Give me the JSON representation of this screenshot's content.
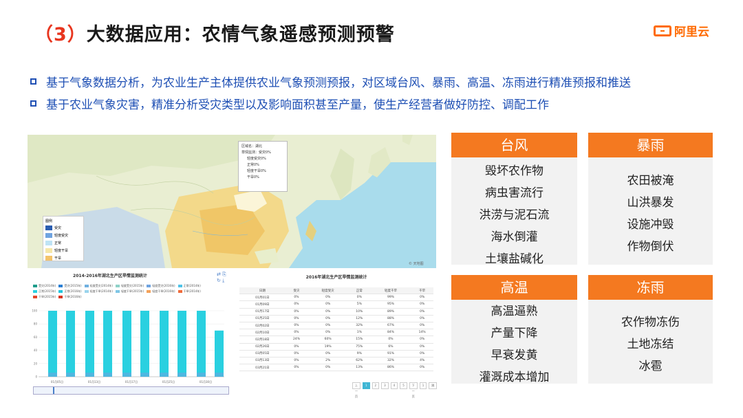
{
  "header": {
    "title_num": "（3）",
    "title_text": "大数据应用：农情气象遥感预测预警",
    "logo_text": "阿里云"
  },
  "bullets": [
    "基于气象数据分析，为农业生产主体提供农业气象预测预报，对区域台风、暴雨、高温、冻雨进行精准预报和推送",
    "基于农业气象灾害，精准分析受灾类型以及影响面积甚至产量，使生产经营者做好防控、调配工作"
  ],
  "map": {
    "tooltip": [
      "区域名：湖北",
      "草情监测：受灾0%",
      "轻度受灾0%",
      "正常0%",
      "轻度干旱0%",
      "干旱0%"
    ],
    "legend_title": "图例",
    "legend": [
      {
        "label": "受灾",
        "color": "#2a5db0"
      },
      {
        "label": "轻度受灾",
        "color": "#6fa3e0"
      },
      {
        "label": "正常",
        "color": "#bfe3f5"
      },
      {
        "label": "轻度干旱",
        "color": "#f6e7a8"
      },
      {
        "label": "干旱",
        "color": "#f4c36a"
      }
    ],
    "credit": "© 天地图"
  },
  "bar_chart": {
    "title": "2014-2016年湖北生产区旱情监测统计",
    "tools": "⇄ ⎘ ↻ ⤓",
    "legend": [
      {
        "label": "受灾(2014年)",
        "color": "#1f9d8b"
      },
      {
        "label": "受灾(2015年)",
        "color": "#2a7fd4"
      },
      {
        "label": "轻度受灾(2014年)",
        "color": "#70b0e0"
      },
      {
        "label": "轻度受灾(2015年)",
        "color": "#8fd1c8"
      },
      {
        "label": "轻度受灾(2016年)",
        "color": "#6fa3e0"
      },
      {
        "label": "正常(2014年)",
        "color": "#4fc3e8"
      },
      {
        "label": "正常(2015年)",
        "color": "#29d0e0"
      },
      {
        "label": "正常(2016年)",
        "color": "#22c6dd"
      },
      {
        "label": "轻度干旱(2014年)",
        "color": "#9ad4ec"
      },
      {
        "label": "轻度干旱(2015年)",
        "color": "#7fc6e6"
      },
      {
        "label": "轻度干旱(2016年)",
        "color": "#f4a15a"
      },
      {
        "label": "干旱(2014年)",
        "color": "#ef6b3a"
      },
      {
        "label": "干旱(2015年)",
        "color": "#e5472b"
      },
      {
        "label": "干旱(2016年)",
        "color": "#d9361e"
      }
    ]
  },
  "chart_data": {
    "type": "bar",
    "title": "2014-2016年湖北生产区旱情监测统计",
    "ylim": [
      0,
      100
    ],
    "yticks": [
      0,
      20,
      40,
      60,
      80,
      100
    ],
    "categories": [
      "01月05日",
      "01月13日",
      "01月17日",
      "01月25日",
      "01月30日"
    ],
    "grid": true,
    "legend_placement": "top",
    "series": [
      {
        "name": "正常(2014年)",
        "color": "#29d0e0",
        "values": [
          100,
          100,
          100,
          100,
          100
        ]
      },
      {
        "name": "正常(2015年)",
        "color": "#29d0e0",
        "values": [
          100,
          100,
          100,
          100,
          70
        ]
      }
    ]
  },
  "table": {
    "title": "2016年湖北生产区旱情监测统计",
    "columns": [
      "日期",
      "受灾",
      "轻度受灾",
      "正常",
      "轻度干旱",
      "干旱"
    ],
    "rows": [
      [
        "01月01日",
        "0%",
        "0%",
        "0%",
        "99%",
        "0%"
      ],
      [
        "01月09日",
        "0%",
        "0%",
        "5%",
        "95%",
        "0%"
      ],
      [
        "01月17日",
        "0%",
        "0%",
        "10%",
        "89%",
        "0%"
      ],
      [
        "01月25日",
        "0%",
        "0%",
        "12%",
        "88%",
        "0%"
      ],
      [
        "02月02日",
        "0%",
        "0%",
        "32%",
        "67%",
        "0%"
      ],
      [
        "02月10日",
        "0%",
        "0%",
        "1%",
        "84%",
        "14%"
      ],
      [
        "02月18日",
        "24%",
        "60%",
        "15%",
        "0%",
        "0%"
      ],
      [
        "02月26日",
        "0%",
        "19%",
        "75%",
        "6%",
        "0%"
      ],
      [
        "03月05日",
        "0%",
        "0%",
        "9%",
        "91%",
        "0%"
      ],
      [
        "03月13日",
        "0%",
        "2%",
        "62%",
        "32%",
        "4%"
      ],
      [
        "03月21日",
        "0%",
        "0%",
        "13%",
        "86%",
        "0%"
      ]
    ],
    "pager": [
      "上一页",
      "1",
      "2",
      "3",
      "4",
      "5",
      "下一页",
      "1",
      "跳"
    ]
  },
  "cards": [
    {
      "title": "台风",
      "items": [
        "毁坏农作物",
        "病虫害流行",
        "洪涝与泥石流",
        "海水倒灌",
        "土壤盐碱化"
      ]
    },
    {
      "title": "暴雨",
      "items": [
        "农田被淹",
        "山洪暴发",
        "设施冲毁",
        "作物倒伏"
      ]
    },
    {
      "title": "高温",
      "items": [
        "高温逼熟",
        "产量下降",
        "早衰发黄",
        "灌溉成本增加"
      ]
    },
    {
      "title": "冻雨",
      "items": [
        "农作物冻伤",
        "土地冻结",
        "冰雹"
      ]
    }
  ]
}
